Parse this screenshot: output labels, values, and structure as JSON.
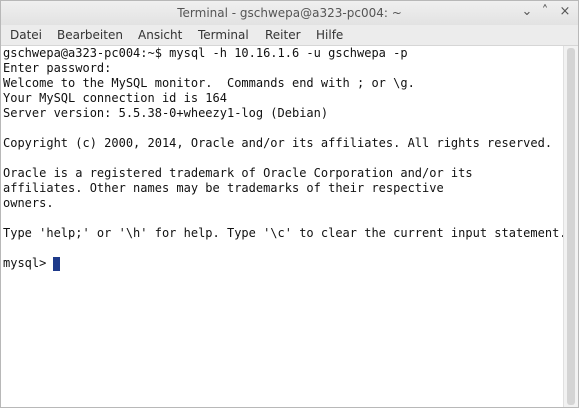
{
  "window": {
    "title": "Terminal - gschwepa@a323-pc004: ~",
    "controls": {
      "minimize": "⌄",
      "maximize": "˄",
      "close": "×"
    }
  },
  "menubar": {
    "items": [
      "Datei",
      "Bearbeiten",
      "Ansicht",
      "Terminal",
      "Reiter",
      "Hilfe"
    ]
  },
  "terminal": {
    "lines": [
      "gschwepa@a323-pc004:~$ mysql -h 10.16.1.6 -u gschwepa -p",
      "Enter password:",
      "Welcome to the MySQL monitor.  Commands end with ; or \\g.",
      "Your MySQL connection id is 164",
      "Server version: 5.5.38-0+wheezy1-log (Debian)",
      "",
      "Copyright (c) 2000, 2014, Oracle and/or its affiliates. All rights reserved.",
      "",
      "Oracle is a registered trademark of Oracle Corporation and/or its",
      "affiliates. Other names may be trademarks of their respective",
      "owners.",
      "",
      "Type 'help;' or '\\h' for help. Type '\\c' to clear the current input statement.",
      ""
    ],
    "prompt": "mysql>"
  }
}
